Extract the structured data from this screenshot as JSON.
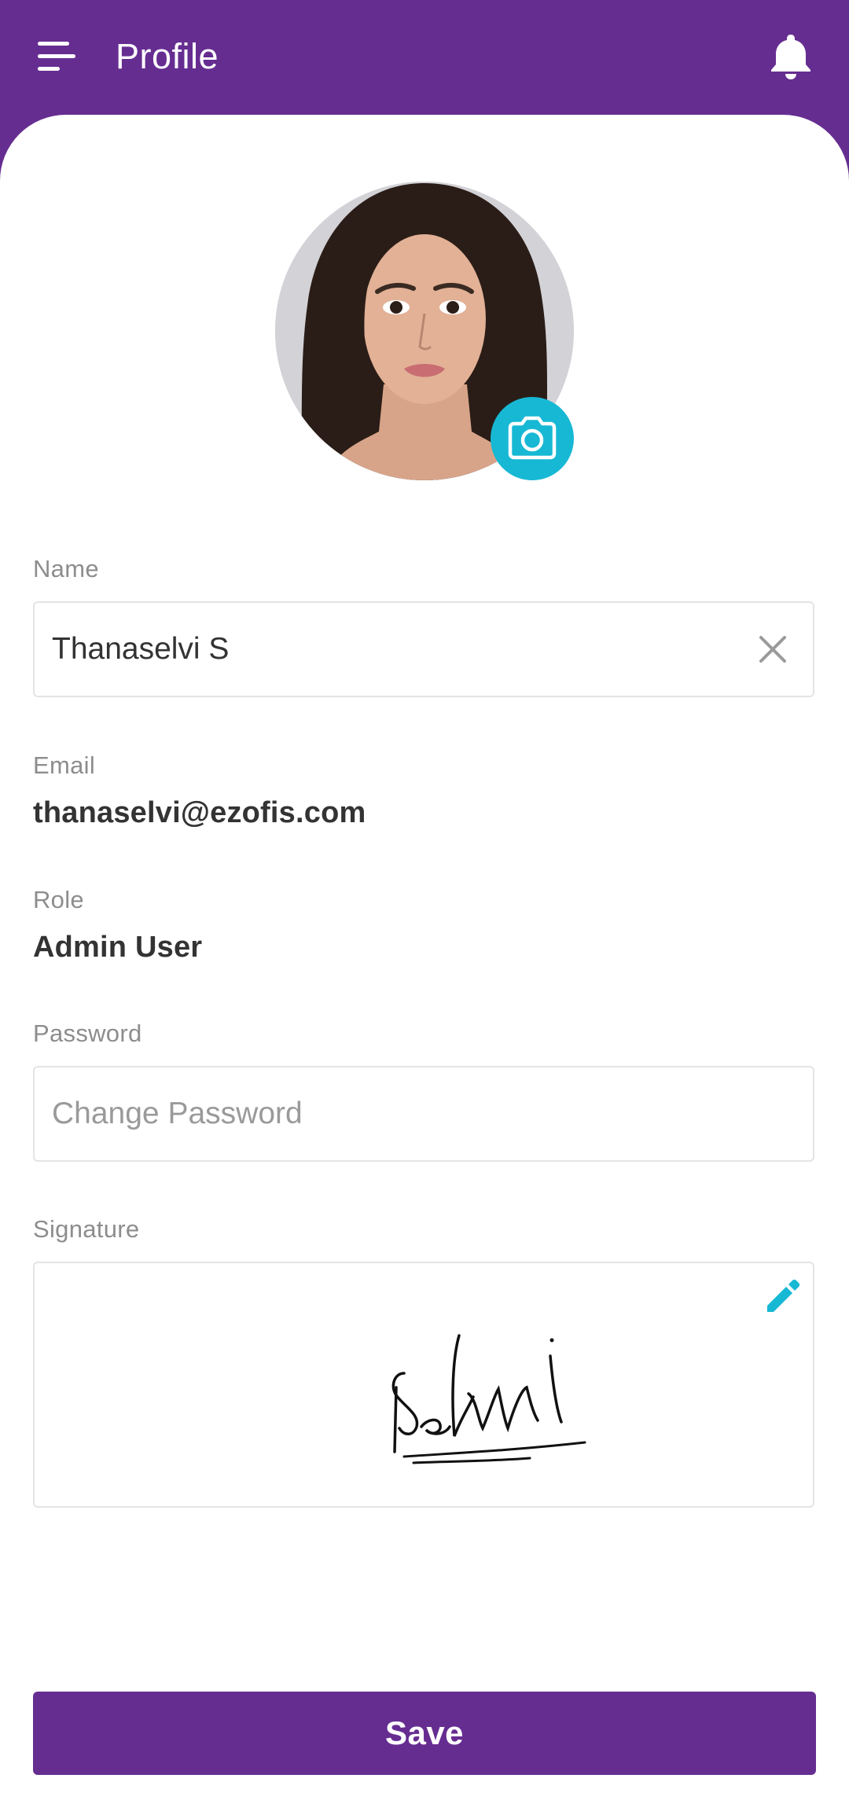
{
  "app_bar": {
    "title": "Profile",
    "menu_icon": "menu-icon",
    "notification_icon": "bell-icon"
  },
  "profile": {
    "photo_alt": "Profile photo",
    "camera_icon": "camera-icon"
  },
  "form": {
    "name": {
      "label": "Name",
      "value": "Thanaselvi S",
      "clear_icon": "close-icon"
    },
    "email": {
      "label": "Email",
      "value": "thanaselvi@ezofis.com"
    },
    "role": {
      "label": "Role",
      "value": "Admin User"
    },
    "password": {
      "label": "Password",
      "value": "",
      "placeholder": "Change Password"
    },
    "signature": {
      "label": "Signature",
      "edit_icon": "pencil-icon"
    }
  },
  "actions": {
    "save_label": "Save"
  },
  "colors": {
    "primary": "#662d91",
    "accent": "#17b8d4",
    "label": "#8d8d8d",
    "text": "#333333",
    "border": "#e4e4e4"
  }
}
